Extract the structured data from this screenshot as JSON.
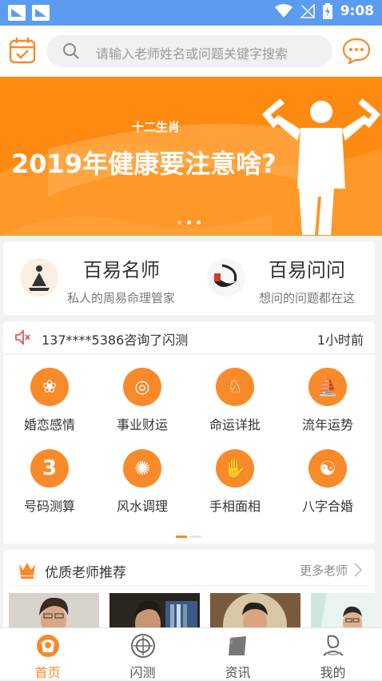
{
  "status_bar": {
    "time": "9:08"
  },
  "search": {
    "placeholder": "请输入老师姓名或问题关键字搜索"
  },
  "banner": {
    "subtitle": "十二生肖",
    "title": "2019年健康要注意啥?"
  },
  "features": [
    {
      "title": "百易名师",
      "subtitle": "私人的周易命理管家"
    },
    {
      "title": "百易问问",
      "subtitle": "想问的问题都在这"
    }
  ],
  "notice": {
    "text": "137****5386咨询了闪测",
    "time": "1小时前"
  },
  "categories": [
    {
      "label": "婚恋感情",
      "icon": "marriage-icon"
    },
    {
      "label": "事业财运",
      "icon": "coin-icon"
    },
    {
      "label": "命运详批",
      "icon": "destiny-icon"
    },
    {
      "label": "流年运势",
      "icon": "ship-icon"
    },
    {
      "label": "号码测算",
      "icon": "number-icon"
    },
    {
      "label": "风水调理",
      "icon": "compass-icon"
    },
    {
      "label": "手相面相",
      "icon": "palm-icon"
    },
    {
      "label": "八字合婚",
      "icon": "taiji-icon"
    }
  ],
  "recommend": {
    "title": "优质老师推荐",
    "more": "更多老师"
  },
  "tabs": [
    {
      "label": "首页",
      "active": true
    },
    {
      "label": "闪测",
      "active": false
    },
    {
      "label": "资讯",
      "active": false
    },
    {
      "label": "我的",
      "active": false
    }
  ],
  "colors": {
    "status_bar": "#5b9cf1",
    "accent": "#f98a2a",
    "banner": "#ff8a12"
  }
}
